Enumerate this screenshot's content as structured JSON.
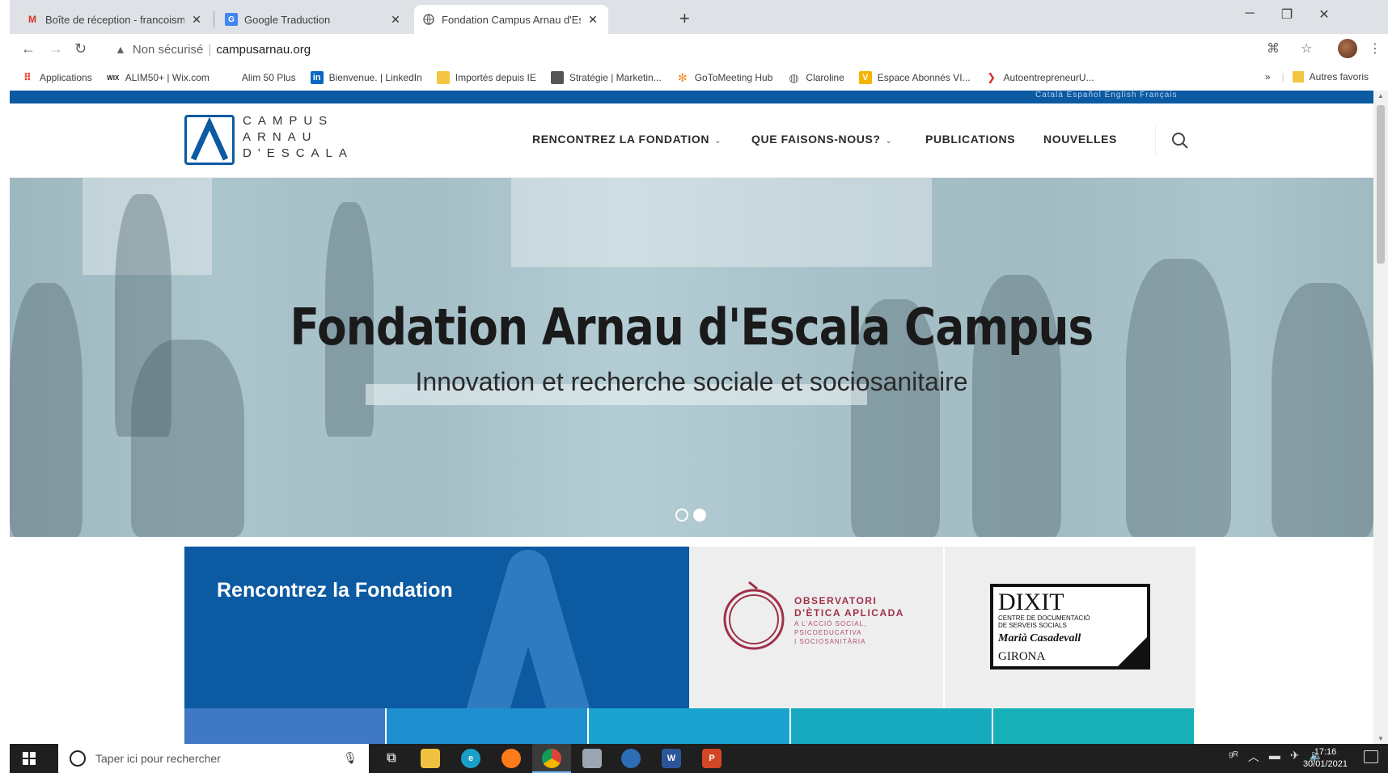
{
  "browser": {
    "tabs": [
      {
        "title": "Boîte de réception - francoismg",
        "favicon": "gmail-icon"
      },
      {
        "title": "Google Traduction",
        "favicon": "google-translate-icon"
      },
      {
        "title": "Fondation Campus Arnau d'Escal",
        "favicon": "globe-icon"
      }
    ],
    "new_tab": "+",
    "address": {
      "security_label": "Non sécurisé",
      "url": "campusarnau.org"
    },
    "bookmarks": [
      {
        "label": "Applications",
        "icon": "apps-grid-icon"
      },
      {
        "label": "ALIM50+ | Wix.com",
        "icon": "wix-icon"
      },
      {
        "label": "Alim 50 Plus",
        "icon": "blank-icon"
      },
      {
        "label": "Bienvenue. | LinkedIn",
        "icon": "linkedin-icon"
      },
      {
        "label": "Importés depuis IE",
        "icon": "folder-icon"
      },
      {
        "label": "Stratégie | Marketin...",
        "icon": "page-icon"
      },
      {
        "label": "GoToMeeting Hub",
        "icon": "gotomeeting-icon"
      },
      {
        "label": "Claroline",
        "icon": "globe-icon"
      },
      {
        "label": "Espace Abonnés VI...",
        "icon": "vi-icon"
      },
      {
        "label": "AutoentrepreneurU...",
        "icon": "auto-icon"
      }
    ],
    "bookmarks_more": "»",
    "other_bookmarks": "Autres favoris"
  },
  "site": {
    "languages": "Català  Español  English  Français",
    "logo_lines": [
      "CAMPUS",
      "ARNAU",
      "D'ESCALA"
    ],
    "nav": [
      {
        "label": "RENCONTREZ LA FONDATION",
        "dropdown": true
      },
      {
        "label": "QUE FAISONS-NOUS?",
        "dropdown": true
      },
      {
        "label": "PUBLICATIONS",
        "dropdown": false
      },
      {
        "label": "NOUVELLES",
        "dropdown": false
      }
    ],
    "hero": {
      "title": "Fondation Arnau d'Escala Campus",
      "subtitle": "Innovation et recherche sociale et sociosanitaire",
      "slides": 2,
      "active_slide": 2
    },
    "tiles": {
      "meet": "Rencontrez la Fondation",
      "observatori": {
        "line1": "OBSERVATORI",
        "line2": "D'ÈTICA APLICADA",
        "small": [
          "A L'ACCIÓ SOCIAL,",
          "PSICOEDUCATIVA",
          "I SOCIOSANITÀRIA"
        ]
      },
      "dixit": {
        "title": "DIXIT",
        "small": [
          "CENTRE DE DOCUMENTACIÓ",
          "DE SERVEIS SOCIALS"
        ],
        "name": "Marià Casadevall",
        "city": "GIRONA"
      },
      "strip_colors": [
        "#3f78c4",
        "#1e8fcf",
        "#1aa3cf",
        "#17aabf",
        "#16b0b8"
      ]
    },
    "colors": {
      "brand_blue": "#0b5aa2",
      "obs_red": "#a1314a"
    }
  },
  "taskbar": {
    "search_placeholder": "Taper ici pour rechercher",
    "time": "17:16",
    "date": "30/01/2021"
  }
}
